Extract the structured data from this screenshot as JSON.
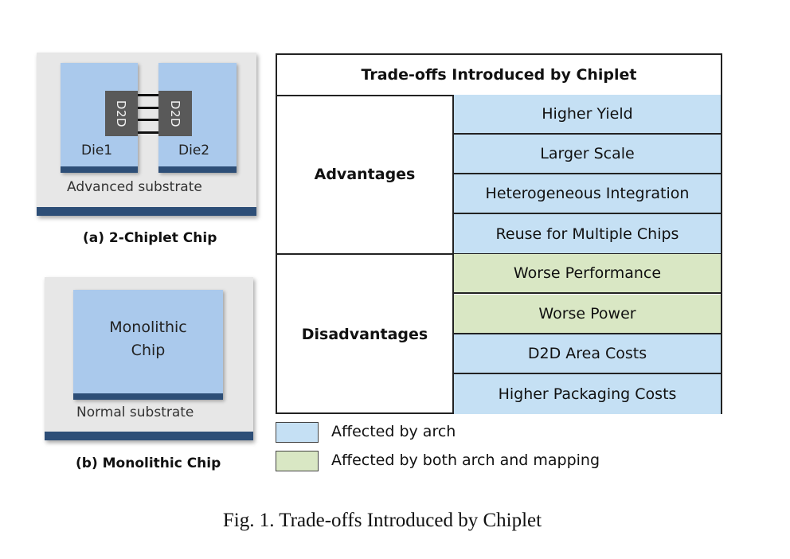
{
  "figure": {
    "caption": "Fig. 1.  Trade-offs Introduced by Chiplet"
  },
  "chiplet_chip": {
    "die1_label": "Die1",
    "die2_label": "Die2",
    "d2d_left_label": "D2D",
    "d2d_right_label": "D2D",
    "interconnect_wires": 4,
    "substrate_label": "Advanced substrate",
    "subfigure_label": "(a) 2-Chiplet Chip"
  },
  "monolithic_chip": {
    "chip_label_line1": "Monolithic",
    "chip_label_line2": "Chip",
    "substrate_label": "Normal substrate",
    "subfigure_label": "(b) Monolithic Chip"
  },
  "table": {
    "title": "Trade-offs Introduced by Chiplet",
    "groups": [
      {
        "label": "Advantages",
        "items": [
          {
            "text": "Higher Yield",
            "category": "arch"
          },
          {
            "text": "Larger Scale",
            "category": "arch"
          },
          {
            "text": "Heterogeneous Integration",
            "category": "arch"
          },
          {
            "text": "Reuse for Multiple Chips",
            "category": "arch"
          }
        ]
      },
      {
        "label": "Disadvantages",
        "items": [
          {
            "text": "Worse Performance",
            "category": "both"
          },
          {
            "text": "Worse Power",
            "category": "both"
          },
          {
            "text": "D2D Area Costs",
            "category": "arch"
          },
          {
            "text": "Higher Packaging Costs",
            "category": "arch"
          }
        ]
      }
    ]
  },
  "legend": {
    "items": [
      {
        "key": "arch",
        "label": "Affected by arch",
        "color": "#c5e0f4"
      },
      {
        "key": "both",
        "label": "Affected by both arch and mapping",
        "color": "#d9e7c4"
      }
    ]
  },
  "colors": {
    "die_fill": "#aac9ec",
    "die_edge": "#2d4e77",
    "d2d_fill": "#595959",
    "substrate_fill": "#e7e7e7"
  }
}
